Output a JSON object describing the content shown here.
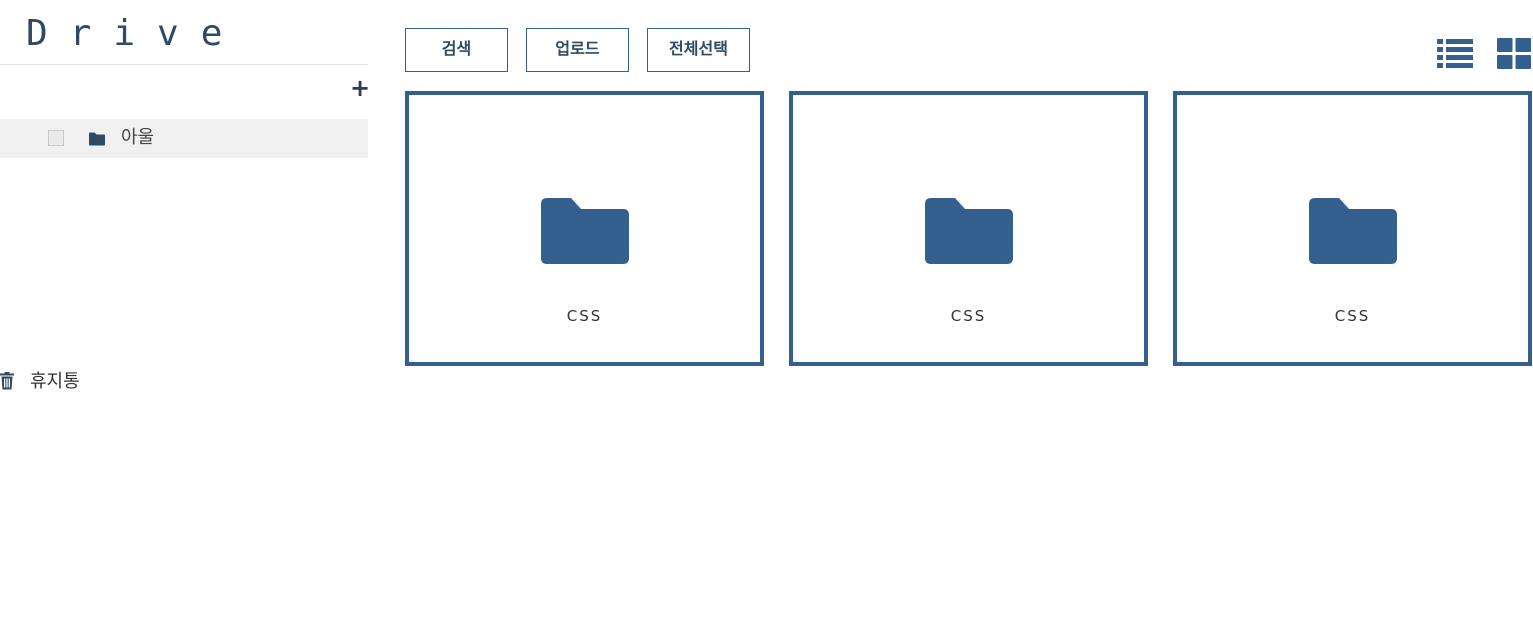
{
  "app": {
    "logo": "Drive"
  },
  "sidebar": {
    "add_label": "+",
    "folders": [
      {
        "label": "아울"
      }
    ],
    "trash_label": "휴지통"
  },
  "toolbar": {
    "search_label": "검색",
    "upload_label": "업로드",
    "select_all_label": "전체선택"
  },
  "view_modes": {
    "list_icon": "list-view-icon",
    "grid_icon": "grid-view-icon",
    "active": "grid"
  },
  "files": [
    {
      "name": "CSS",
      "type": "folder"
    },
    {
      "name": "CSS",
      "type": "folder"
    },
    {
      "name": "CSS",
      "type": "folder"
    }
  ],
  "colors": {
    "accent": "#33608f",
    "row_highlight": "#f0f0f0"
  }
}
